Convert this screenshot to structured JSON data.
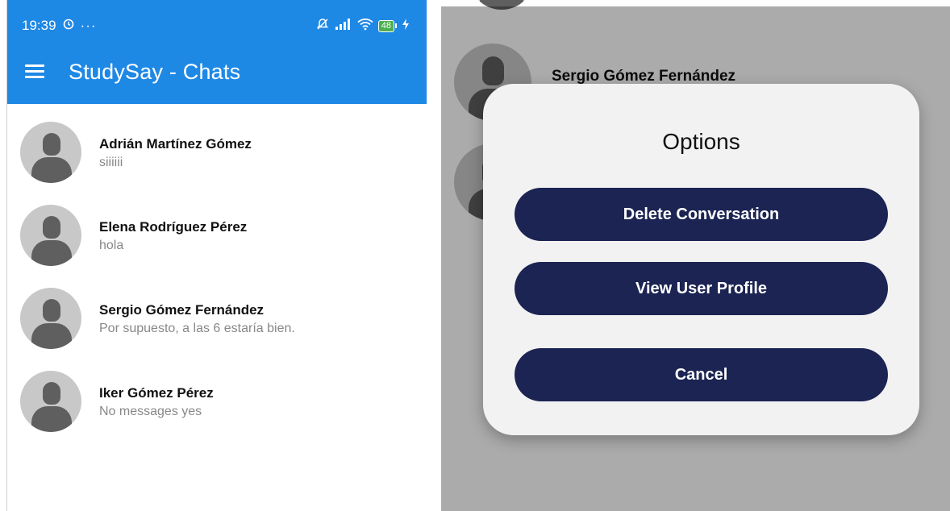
{
  "status_bar": {
    "time": "19:39",
    "icons_left": [
      "clock-icon",
      "more-dots-icon"
    ],
    "icons_right": [
      "muted-bell-icon",
      "signal-icon",
      "wifi-icon",
      "battery-icon",
      "charging-icon"
    ],
    "battery": "48"
  },
  "app_bar": {
    "title": "StudySay - Chats",
    "color": "#1E88E5"
  },
  "chats": [
    {
      "name": "Adrián Martínez Gómez",
      "last_message": "siiiiii"
    },
    {
      "name": "Elena Rodríguez Pérez",
      "last_message": "hola"
    },
    {
      "name": "Sergio Gómez Fernández",
      "last_message": "Por supuesto, a las 6 estaría bien."
    },
    {
      "name": "Iker Gómez Pérez",
      "last_message": "No messages yes"
    }
  ],
  "background_chat": {
    "name": "Sergio Gómez Fernández"
  },
  "dialog": {
    "title": "Options",
    "buttons": {
      "delete": "Delete Conversation",
      "profile": "View User Profile",
      "cancel": "Cancel"
    },
    "button_color": "#1b2452"
  }
}
